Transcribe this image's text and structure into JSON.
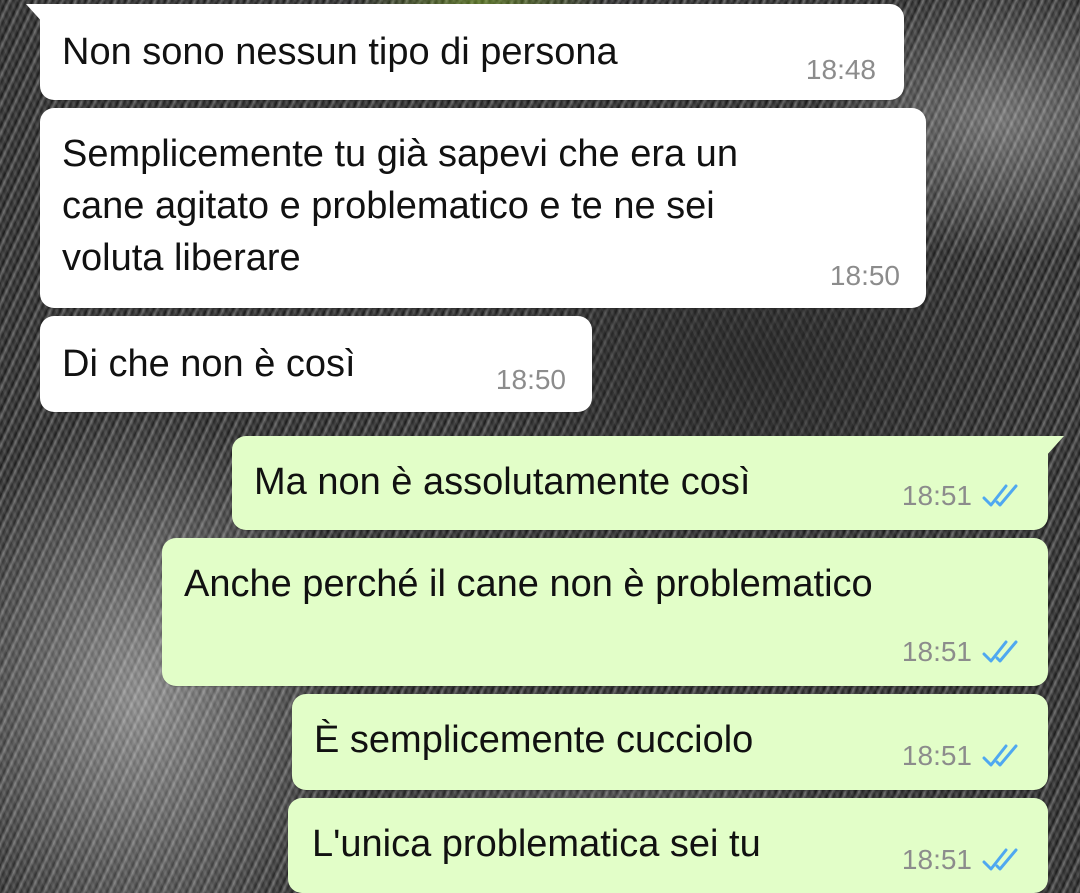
{
  "theme": {
    "incoming_bubble": "#ffffff",
    "outgoing_bubble": "#e2fec8",
    "read_tick_color": "#4fa8f0",
    "timestamp_color": "#8c8c8c"
  },
  "messages": [
    {
      "direction": "incoming",
      "text": "Non sono nessun tipo di persona",
      "time": "18:48"
    },
    {
      "direction": "incoming",
      "text": "Semplicemente tu già sapevi che era un\ncane agitato e problematico e te ne sei\nvoluta liberare",
      "time": "18:50"
    },
    {
      "direction": "incoming",
      "text": "Di che non è così",
      "time": "18:50"
    },
    {
      "direction": "outgoing",
      "text": "Ma non è assolutamente così",
      "time": "18:51",
      "status_icon": "double-check-read-icon"
    },
    {
      "direction": "outgoing",
      "text": "Anche perché il cane non è problematico",
      "time": "18:51",
      "status_icon": "double-check-read-icon"
    },
    {
      "direction": "outgoing",
      "text": "È semplicemente cucciolo",
      "time": "18:51",
      "status_icon": "double-check-read-icon"
    },
    {
      "direction": "outgoing",
      "text": "L'unica problematica sei tu",
      "time": "18:51",
      "status_icon": "double-check-read-icon"
    }
  ]
}
